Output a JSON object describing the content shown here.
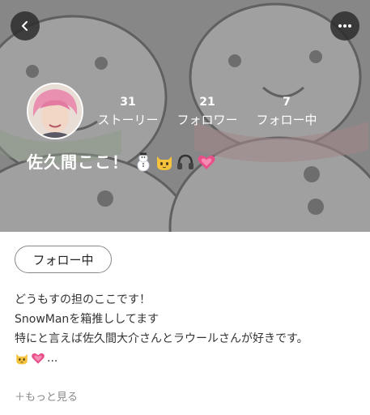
{
  "header": {
    "back_icon": "chevron-left-icon",
    "more_icon": "more-horizontal-icon",
    "stats": [
      {
        "count": "31",
        "label": "ストーリー"
      },
      {
        "count": "21",
        "label": "フォロワー"
      },
      {
        "count": "7",
        "label": "フォロー中"
      }
    ],
    "name": "佐久間ここ！",
    "name_emojis": [
      "snowman-emoji",
      "cat-emoji",
      "headphones-emoji",
      "growing-heart-emoji"
    ]
  },
  "actions": {
    "follow_label": "フォロー中"
  },
  "bio": {
    "lines": [
      "どうもすの担のここです！",
      "SnowManを箱推ししてます",
      "特にと言えば佐久間大介さんとラウールさんが好きです。"
    ],
    "line4_emojis": [
      "cat-emoji",
      "growing-heart-emoji"
    ],
    "line4_suffix": "...",
    "more_label": "＋もっと見る"
  },
  "colors": {
    "header_overlay": "#8f8f8f",
    "button_dark": "#2d2d2d",
    "heart_pink": "#e8508a",
    "cat_yellow": "#f5c33b"
  }
}
